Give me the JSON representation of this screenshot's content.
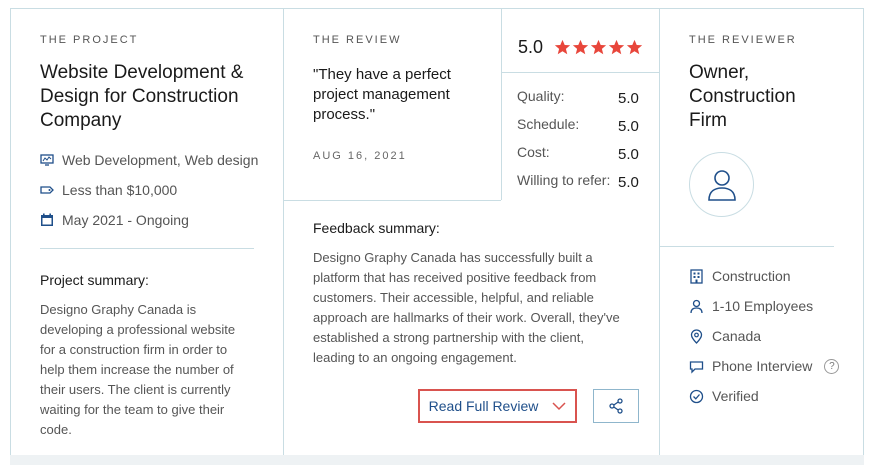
{
  "project": {
    "eyebrow": "THE PROJECT",
    "title_lines": [
      "Website Development &",
      "Design for Construction",
      "Company"
    ],
    "services": "Web Development, Web design",
    "budget": "Less than $10,000",
    "timeline": "May 2021 - Ongoing",
    "summary_heading": "Project summary:",
    "summary_lines": [
      "Designo Graphy Canada is",
      "developing a professional website",
      "for a construction firm in order to",
      "help them increase the number of",
      "their users. The client is currently",
      "waiting for the team to give their",
      "code."
    ]
  },
  "review": {
    "eyebrow": "THE REVIEW",
    "quote_lines": [
      "\"They have a perfect",
      "project management",
      "process.\""
    ],
    "date": "AUG 16, 2021",
    "overall_score": "5.0",
    "stars": 5,
    "ratings": [
      {
        "label": "Quality:",
        "value": "5.0"
      },
      {
        "label": "Schedule:",
        "value": "5.0"
      },
      {
        "label": "Cost:",
        "value": "5.0"
      },
      {
        "label": "Willing to refer:",
        "value": "5.0"
      }
    ],
    "feedback_heading": "Feedback summary:",
    "feedback_lines": [
      "Designo Graphy Canada has successfully built a",
      "platform that has received positive feedback from",
      "customers. Their accessible, helpful, and reliable",
      "approach are hallmarks of their work. Overall, they've",
      "established a strong partnership with the client,",
      "leading to an ongoing engagement."
    ],
    "read_full_label": "Read Full Review"
  },
  "reviewer": {
    "eyebrow": "THE REVIEWER",
    "title_lines": [
      "Owner,",
      "Construction",
      "Firm"
    ],
    "industry": "Construction",
    "size": "1-10 Employees",
    "location": "Canada",
    "interview": "Phone Interview",
    "verified": "Verified",
    "help_glyph": "?"
  },
  "colors": {
    "star": "#e8463b",
    "border": "#c9dde3",
    "button_border": "#d9534f",
    "link_text": "#1f4f8a",
    "icon": "#1f4f8a"
  }
}
